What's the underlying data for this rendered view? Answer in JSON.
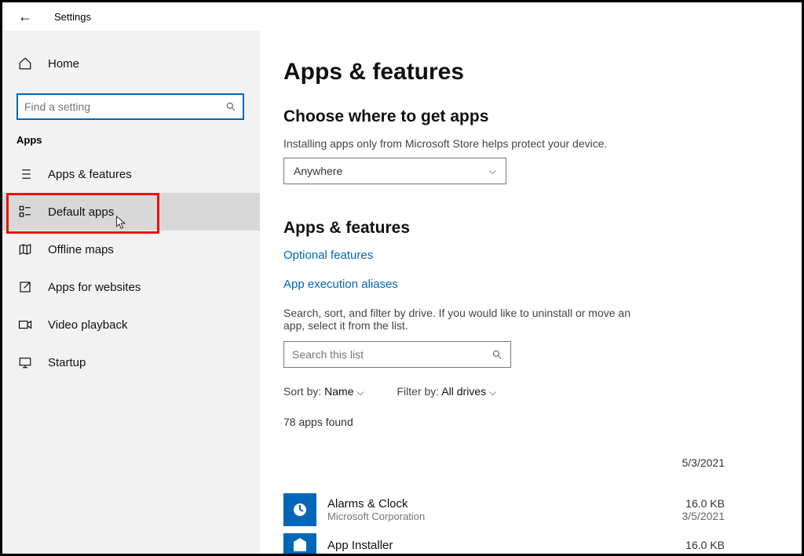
{
  "titlebar": {
    "label": "Settings"
  },
  "sidebar": {
    "home": "Home",
    "search_placeholder": "Find a setting",
    "group": "Apps",
    "items": [
      {
        "label": "Apps & features"
      },
      {
        "label": "Default apps"
      },
      {
        "label": "Offline maps"
      },
      {
        "label": "Apps for websites"
      },
      {
        "label": "Video playback"
      },
      {
        "label": "Startup"
      }
    ]
  },
  "main": {
    "title": "Apps & features",
    "source_heading": "Choose where to get apps",
    "source_helper": "Installing apps only from Microsoft Store helps protect your device.",
    "source_value": "Anywhere",
    "section2": "Apps & features",
    "link_optional": "Optional features",
    "link_aliases": "App execution aliases",
    "list_helper": "Search, sort, and filter by drive. If you would like to uninstall or move an app, select it from the list.",
    "list_search_placeholder": "Search this list",
    "sort_label": "Sort by:",
    "sort_value": "Name",
    "filter_label": "Filter by:",
    "filter_value": "All drives",
    "count": "78 apps found",
    "top_date": "5/3/2021",
    "apps": [
      {
        "name": "Alarms & Clock",
        "publisher": "Microsoft Corporation",
        "size": "16.0 KB",
        "date": "3/5/2021"
      },
      {
        "name": "App Installer",
        "publisher": "",
        "size": "16.0 KB",
        "date": ""
      }
    ]
  }
}
